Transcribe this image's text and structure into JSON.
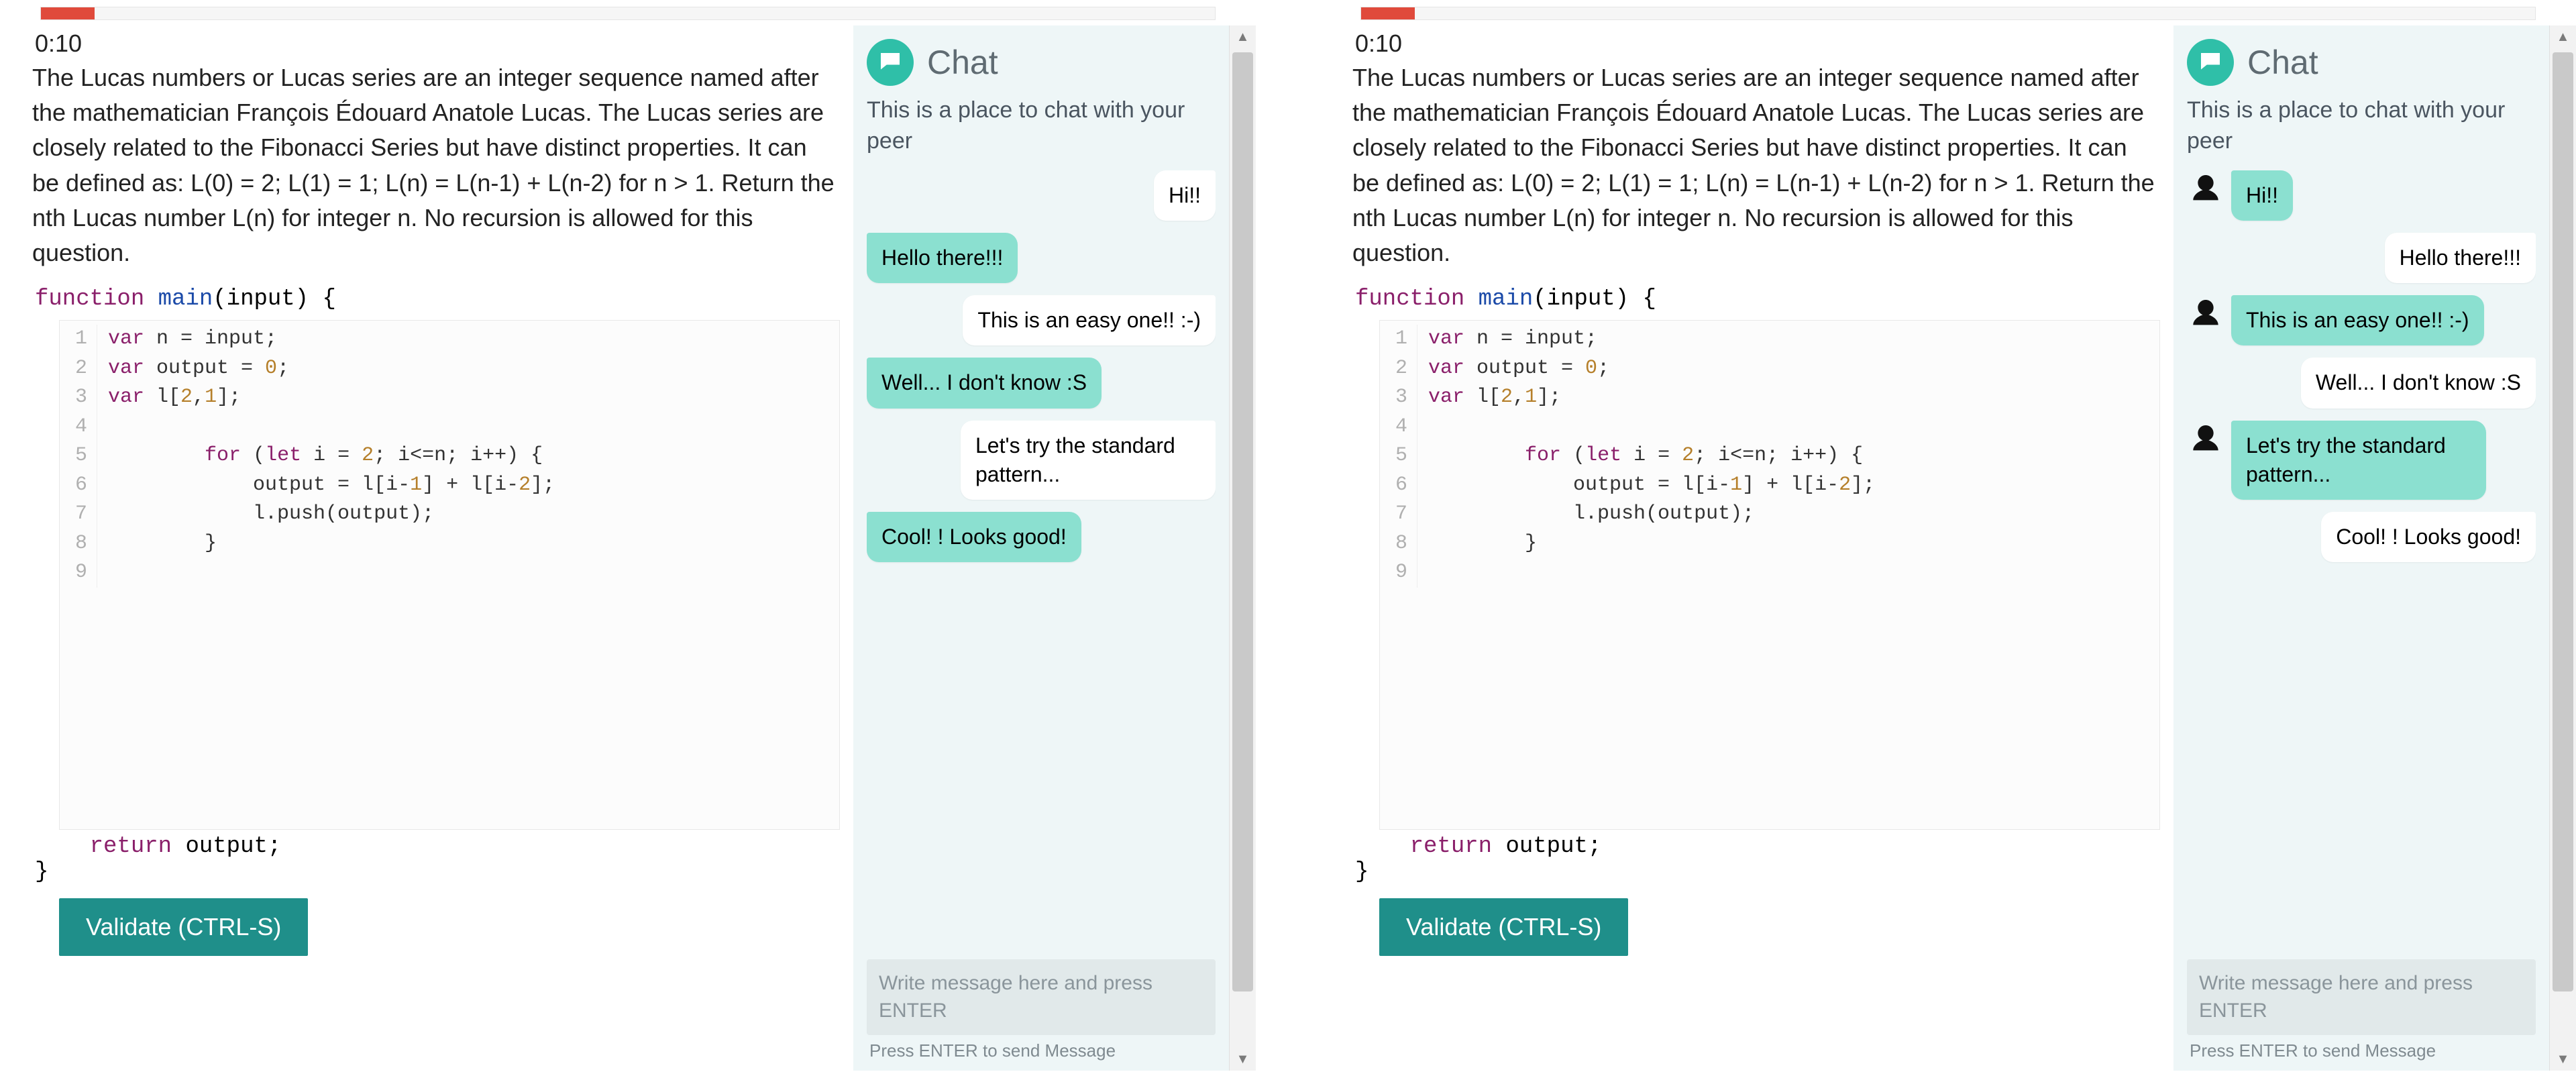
{
  "colors": {
    "accent_teal": "#1f8f8a",
    "bubble_mine": "#8be0d0",
    "progress_fill": "#e04a3b"
  },
  "problem": {
    "timer": "0:10",
    "prompt": "The Lucas numbers or Lucas series are an integer sequence named after the mathematician François Édouard Anatole Lucas. The Lucas series are closely related to the Fibonacci Series but have distinct properties. It can be defined as: L(0) = 2; L(1) = 1; L(n) = L(n-1) + L(n-2) for n > 1. Return the nth Lucas number L(n) for integer n. No recursion is allowed for this question.",
    "signature_open": "function main(input) {",
    "return_line": "    return output;",
    "signature_close": "}",
    "validate_label": "Validate (CTRL-S)"
  },
  "editor_lines": [
    {
      "n": "1",
      "text": "var n = input;"
    },
    {
      "n": "2",
      "text": "var output = 0;"
    },
    {
      "n": "3",
      "text": "var l[2,1];"
    },
    {
      "n": "4",
      "text": ""
    },
    {
      "n": "5",
      "text": "        for (let i = 2; i<=n; i++) {"
    },
    {
      "n": "6",
      "text": "            output = l[i-1] + l[i-2];"
    },
    {
      "n": "7",
      "text": "            l.push(output);"
    },
    {
      "n": "8",
      "text": "        }"
    },
    {
      "n": "9",
      "text": ""
    }
  ],
  "chat": {
    "title": "Chat",
    "subtitle": "This is a place to chat with your peer",
    "input_placeholder": "Write message here and press ENTER",
    "hint": "Press ENTER to send Message"
  },
  "chat_a": {
    "show_avatars": false,
    "messages": [
      {
        "from": "peer",
        "text": "Hi!!"
      },
      {
        "from": "me",
        "text": "Hello there!!!"
      },
      {
        "from": "peer",
        "text": "This is an easy one!! :-)"
      },
      {
        "from": "me",
        "text": "Well... I don't know :S"
      },
      {
        "from": "peer",
        "text": "Let's try the standard pattern..."
      },
      {
        "from": "me",
        "text": "Cool! ! Looks good!"
      }
    ]
  },
  "chat_b": {
    "show_avatars": true,
    "messages": [
      {
        "from": "me",
        "text": "Hi!!"
      },
      {
        "from": "peer",
        "text": "Hello there!!!"
      },
      {
        "from": "me",
        "text": "This is an easy one!! :-)"
      },
      {
        "from": "peer",
        "text": "Well... I don't know :S"
      },
      {
        "from": "me",
        "text": "Let's try the standard pattern..."
      },
      {
        "from": "peer",
        "text": "Cool! ! Looks good!"
      }
    ]
  }
}
